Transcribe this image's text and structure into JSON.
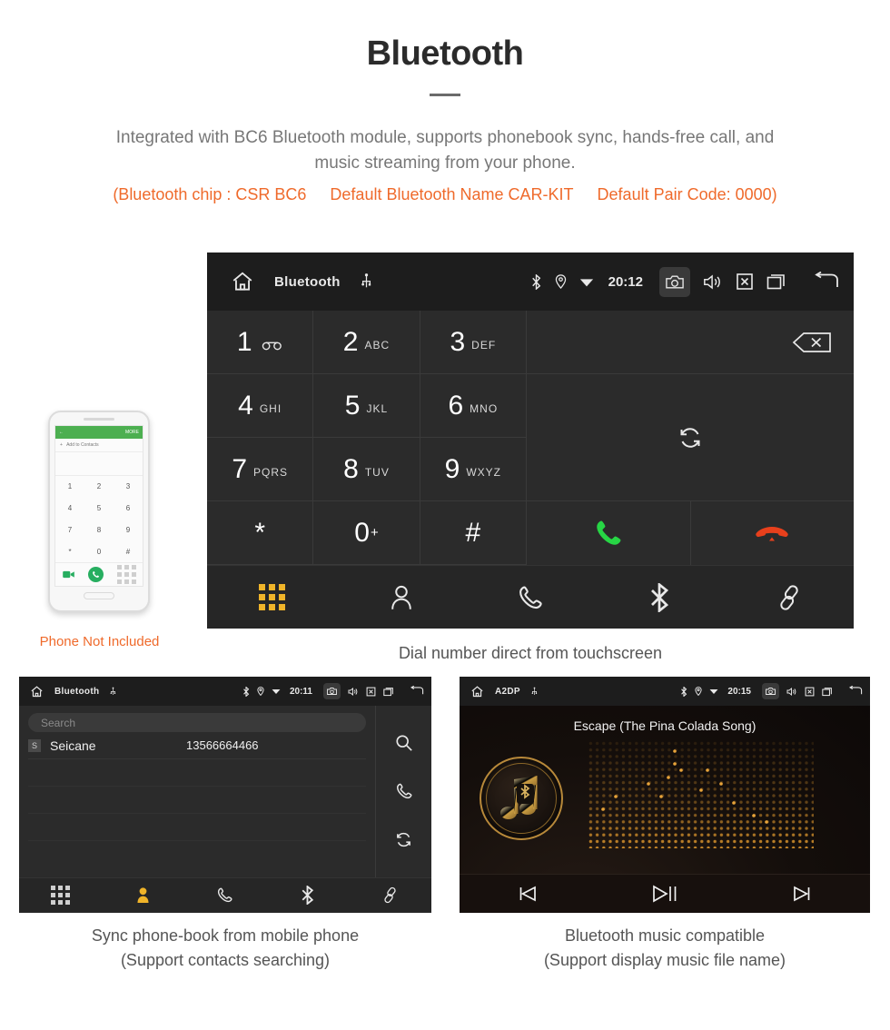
{
  "header": {
    "title": "Bluetooth",
    "description_line1": "Integrated with BC6 Bluetooth module, supports phonebook sync, hands-free call, and",
    "description_line2": "music streaming from your phone.",
    "spec_chip": "(Bluetooth chip : CSR BC6",
    "spec_name": "Default Bluetooth Name CAR-KIT",
    "spec_pair": "Default Pair Code: 0000)",
    "accent_color": "#ef6a2b"
  },
  "dialer": {
    "statusbar": {
      "home_icon": "home-icon",
      "title": "Bluetooth",
      "usb_icon": "usb-icon",
      "bluetooth_icon": "bluetooth-icon",
      "location_icon": "location-icon",
      "wifi_icon": "wifi-icon",
      "time": "20:12",
      "camera_icon": "camera-icon",
      "volume_icon": "volume-icon",
      "close_icon": "close-box-icon",
      "recents_icon": "recents-icon",
      "back_icon": "back-icon"
    },
    "keys": [
      {
        "digit": "1",
        "letters": "",
        "icon": "voicemail-icon"
      },
      {
        "digit": "2",
        "letters": "ABC",
        "icon": ""
      },
      {
        "digit": "3",
        "letters": "DEF",
        "icon": ""
      },
      {
        "digit": "4",
        "letters": "GHI",
        "icon": ""
      },
      {
        "digit": "5",
        "letters": "JKL",
        "icon": ""
      },
      {
        "digit": "6",
        "letters": "MNO",
        "icon": ""
      },
      {
        "digit": "7",
        "letters": "PQRS",
        "icon": ""
      },
      {
        "digit": "8",
        "letters": "TUV",
        "icon": ""
      },
      {
        "digit": "9",
        "letters": "WXYZ",
        "icon": ""
      },
      {
        "digit": "*",
        "letters": "",
        "icon": ""
      },
      {
        "digit": "0",
        "letters": "",
        "icon": "",
        "superscript": "+"
      },
      {
        "digit": "#",
        "letters": "",
        "icon": ""
      }
    ],
    "backspace_icon": "backspace-icon",
    "sync_icon": "sync-icon",
    "call_icon": "call-icon",
    "call_color": "#27d545",
    "hangup_icon": "hangup-icon",
    "hangup_color": "#e8401c",
    "navbar": [
      {
        "name": "keypad-tab",
        "icon": "keypad-grid-icon",
        "active": true
      },
      {
        "name": "contacts-tab",
        "icon": "person-icon",
        "active": false
      },
      {
        "name": "calls-tab",
        "icon": "phone-handset-icon",
        "active": false
      },
      {
        "name": "bluetooth-tab",
        "icon": "bluetooth-icon",
        "active": false
      },
      {
        "name": "link-tab",
        "icon": "link-icon",
        "active": false
      }
    ],
    "active_color": "#f0b429",
    "caption": "Dial number direct from touchscreen"
  },
  "phone_mockup": {
    "topbar_more": "MORE",
    "back_arrow": "←",
    "add_contacts": "Add to Contacts",
    "plus": "+",
    "keys": [
      "1",
      "2",
      "3",
      "4",
      "5",
      "6",
      "7",
      "8",
      "9",
      "*",
      "0",
      "#"
    ],
    "note": "Phone Not Included",
    "note_color": "#ef6a2b"
  },
  "phonebook": {
    "statusbar": {
      "title": "Bluetooth",
      "time": "20:11"
    },
    "search_placeholder": "Search",
    "contacts": [
      {
        "badge": "S",
        "name": "Seicane",
        "number": "13566664466"
      }
    ],
    "sidebar": [
      {
        "name": "search-action",
        "icon": "search-icon"
      },
      {
        "name": "call-action",
        "icon": "phone-handset-icon"
      },
      {
        "name": "sync-action",
        "icon": "sync-icon"
      }
    ],
    "navbar": [
      {
        "name": "keypad-tab",
        "icon": "keypad-grid-icon",
        "active": false
      },
      {
        "name": "contacts-tab",
        "icon": "person-icon",
        "active": true
      },
      {
        "name": "calls-tab",
        "icon": "phone-handset-icon",
        "active": false
      },
      {
        "name": "bluetooth-tab",
        "icon": "bluetooth-icon",
        "active": false
      },
      {
        "name": "link-tab",
        "icon": "link-icon",
        "active": false
      }
    ],
    "caption_line1": "Sync phone-book from mobile phone",
    "caption_line2": "(Support contacts searching)"
  },
  "a2dp": {
    "statusbar": {
      "title": "A2DP",
      "time": "20:15"
    },
    "song_title": "Escape (The Pina Colada Song)",
    "album_icon": "bluetooth-music-note-icon",
    "controls": [
      {
        "name": "previous-button",
        "icon": "skip-previous-icon"
      },
      {
        "name": "play-pause-button",
        "icon": "play-pause-icon"
      },
      {
        "name": "next-button",
        "icon": "skip-next-icon"
      }
    ],
    "caption_line1": "Bluetooth music compatible",
    "caption_line2": "(Support display music file name)"
  }
}
